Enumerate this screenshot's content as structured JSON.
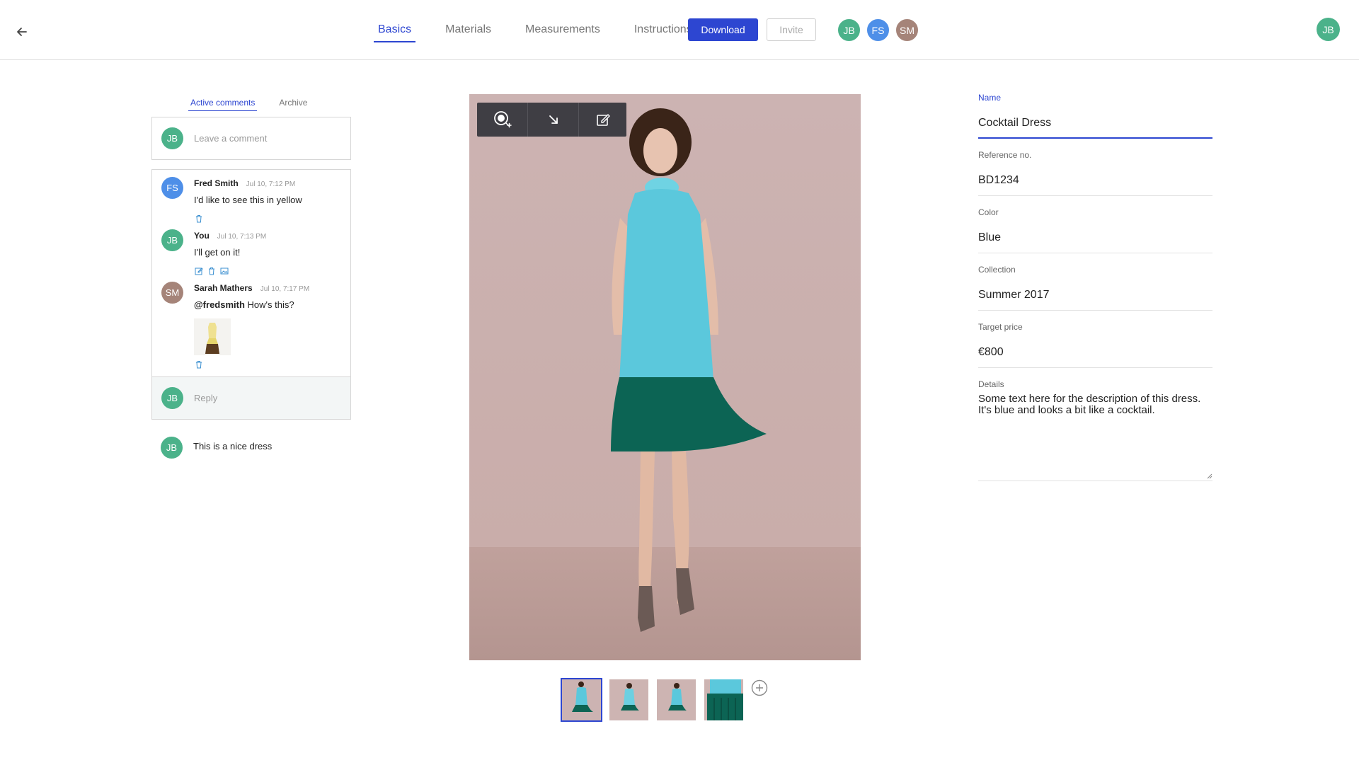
{
  "header": {
    "tabs": [
      {
        "label": "Basics",
        "active": true
      },
      {
        "label": "Materials",
        "active": false
      },
      {
        "label": "Measurements",
        "active": false
      },
      {
        "label": "Instructions",
        "active": false
      }
    ],
    "download_label": "Download",
    "invite_label": "Invite",
    "collaborators": [
      {
        "initials": "JB",
        "color": "#4bb28a"
      },
      {
        "initials": "FS",
        "color": "#4e8fe8"
      },
      {
        "initials": "SM",
        "color": "#a58479"
      }
    ],
    "current_user": {
      "initials": "JB",
      "color": "#4bb28a"
    }
  },
  "comments": {
    "tabs": [
      {
        "label": "Active comments",
        "active": true
      },
      {
        "label": "Archive",
        "active": false
      }
    ],
    "new_comment": {
      "avatar": "JB",
      "placeholder": "Leave a comment"
    },
    "thread": [
      {
        "avatar": "FS",
        "name": "Fred Smith",
        "time": "Jul 10, 7:12 PM",
        "text": "I'd like to see this in yellow",
        "actions": [
          "trash-icon"
        ]
      },
      {
        "avatar": "JB",
        "name": "You",
        "time": "Jul 10, 7:13 PM",
        "text": "I'll get on it!",
        "actions": [
          "edit-icon",
          "trash-icon",
          "image-icon"
        ]
      },
      {
        "avatar": "SM",
        "name": "Sarah Mathers",
        "time": "Jul 10, 7:17 PM",
        "mention": "@fredsmith",
        "text": " How's this?",
        "actions": [
          "trash-icon"
        ],
        "has_attachment": true
      }
    ],
    "reply": {
      "avatar": "JB",
      "placeholder": "Reply"
    },
    "standalone": {
      "avatar": "JB",
      "text": "This is a nice dress"
    }
  },
  "viewer": {
    "tools": [
      "magnify-add-icon",
      "arrow-down-right-icon",
      "edit-icon"
    ],
    "thumbnails": 4,
    "active_thumbnail": 0,
    "add_icon": "plus-circle-icon"
  },
  "form": {
    "fields": [
      {
        "label": "Name",
        "value": "Cocktail Dress"
      },
      {
        "label": "Reference no.",
        "value": "BD1234"
      },
      {
        "label": "Color",
        "value": "Blue"
      },
      {
        "label": "Collection",
        "value": "Summer 2017"
      },
      {
        "label": "Target price",
        "value": "€800"
      }
    ],
    "details_label": "Details",
    "details_value": "Some text here for the description of this dress. It's blue and looks a bit like a cocktail."
  },
  "colors": {
    "accent": "#2d46d1",
    "dress_top": "#5cc8dc",
    "dress_skirt": "#0c6455",
    "backdrop": "#cbb0ad"
  }
}
